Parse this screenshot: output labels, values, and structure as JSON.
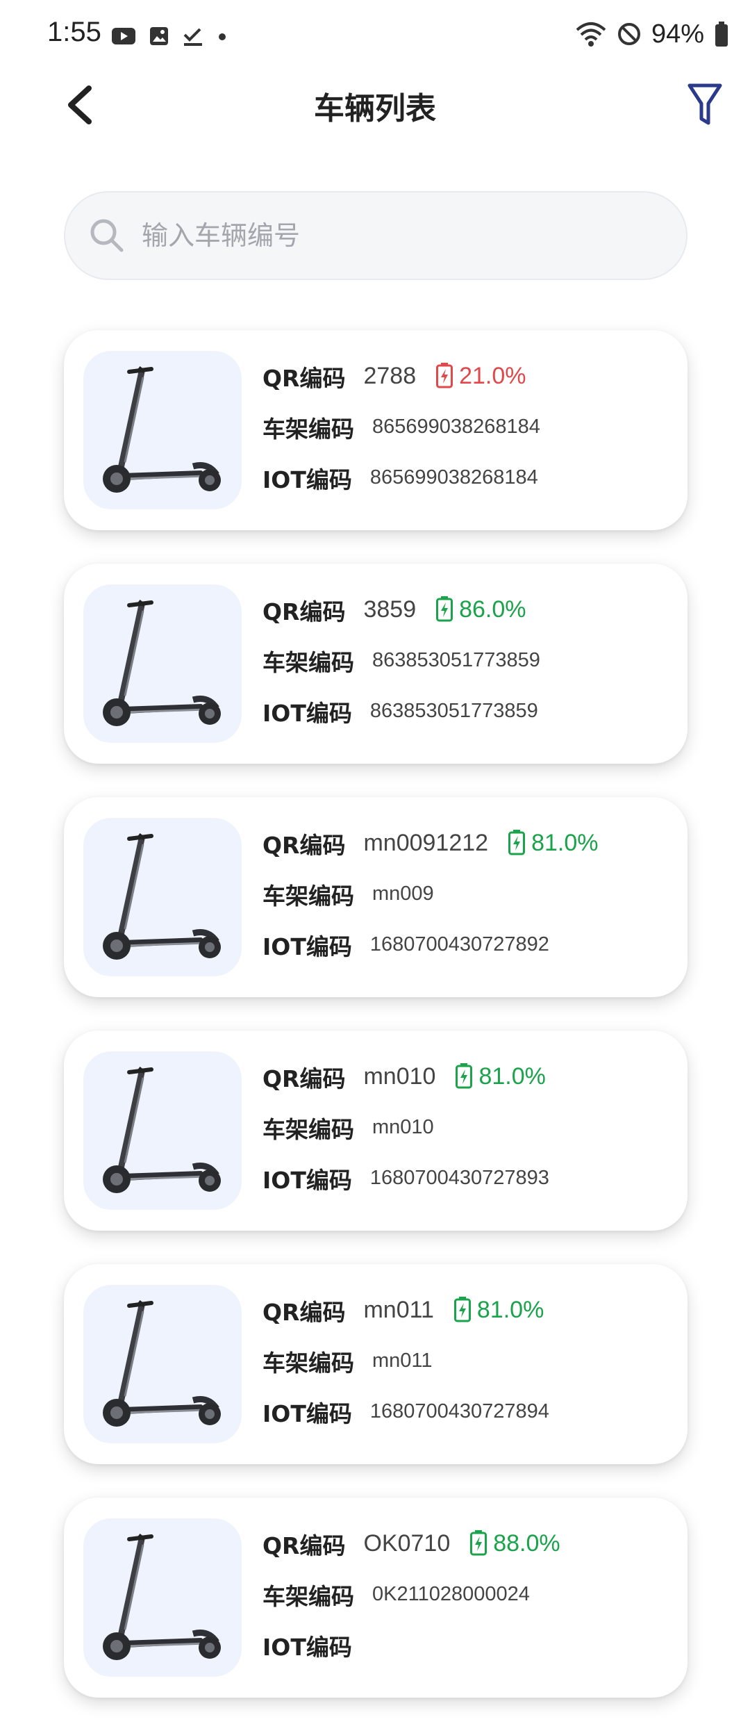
{
  "status_bar": {
    "time": "1:55",
    "battery": "94%"
  },
  "header": {
    "title": "车辆列表"
  },
  "search": {
    "placeholder": "输入车辆编号"
  },
  "labels": {
    "qr": "QR编码",
    "frame": "车架编码",
    "iot": "IOT编码"
  },
  "colors": {
    "low_battery": "#e0484a",
    "ok_battery": "#1aa34a",
    "accent": "#2b3a8a"
  },
  "vehicles": [
    {
      "qr": "2788",
      "battery": "21.0%",
      "battery_status": "low",
      "frame": "865699038268184",
      "iot": "865699038268184"
    },
    {
      "qr": "3859",
      "battery": "86.0%",
      "battery_status": "ok",
      "frame": "863853051773859",
      "iot": "863853051773859"
    },
    {
      "qr": "mn0091212",
      "battery": "81.0%",
      "battery_status": "ok",
      "frame": "mn009",
      "iot": "1680700430727892"
    },
    {
      "qr": "mn010",
      "battery": "81.0%",
      "battery_status": "ok",
      "frame": "mn010",
      "iot": "1680700430727893"
    },
    {
      "qr": "mn011",
      "battery": "81.0%",
      "battery_status": "ok",
      "frame": "mn011",
      "iot": "1680700430727894"
    },
    {
      "qr": "OK0710",
      "battery": "88.0%",
      "battery_status": "ok",
      "frame": "0K211028000024",
      "iot": ""
    }
  ]
}
